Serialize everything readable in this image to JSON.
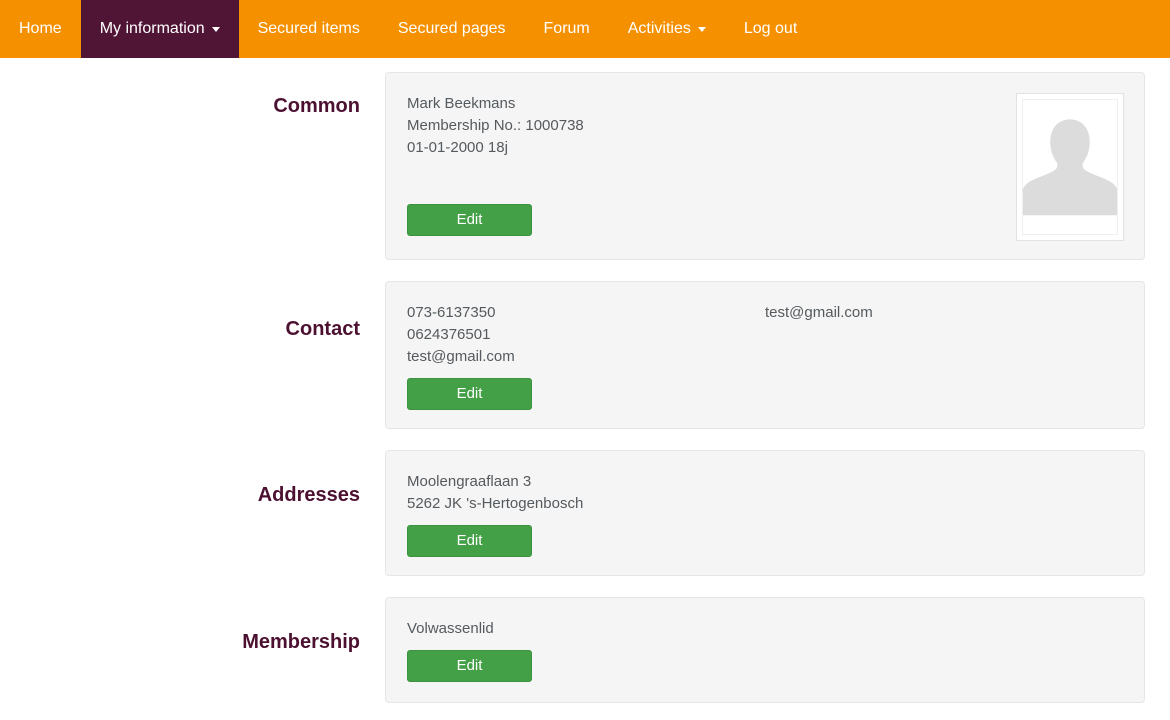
{
  "navbar": {
    "background_color": "#f59100",
    "active_color": "#501534",
    "items": [
      {
        "label": "Home",
        "active": false,
        "caret": false
      },
      {
        "label": "My information",
        "active": true,
        "caret": true
      },
      {
        "label": "Secured items",
        "active": false,
        "caret": false
      },
      {
        "label": "Secured pages",
        "active": false,
        "caret": false
      },
      {
        "label": "Forum",
        "active": false,
        "caret": false
      },
      {
        "label": "Activities",
        "active": false,
        "caret": true
      },
      {
        "label": "Log out",
        "active": false,
        "caret": false
      }
    ]
  },
  "sections": {
    "common": {
      "title": "Common",
      "lines": [
        "Mark Beekmans",
        "Membership No.: 1000738",
        "01-01-2000 18j"
      ],
      "edit_label": "Edit",
      "avatar_icon": "person-silhouette-placeholder"
    },
    "contact": {
      "title": "Contact",
      "lines": [
        "073-6137350",
        "0624376501",
        "test@gmail.com"
      ],
      "secondary_column": "test@gmail.com",
      "edit_label": "Edit"
    },
    "addresses": {
      "title": "Addresses",
      "lines": [
        "Moolengraaflaan 3",
        "5262 JK 's-Hertogenbosch"
      ],
      "edit_label": "Edit"
    },
    "membership": {
      "title": "Membership",
      "lines": [
        "Volwassenlid"
      ],
      "edit_label": "Edit"
    }
  },
  "theme": {
    "heading_color": "#4c1130",
    "panel_background": "#f5f5f5",
    "button_color": "#43a047",
    "text_color": "#555a5e"
  }
}
